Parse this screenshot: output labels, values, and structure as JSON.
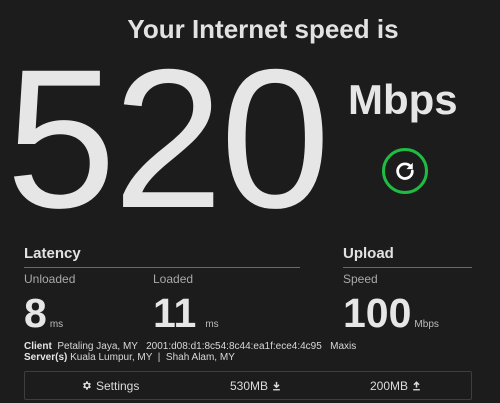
{
  "header": {
    "title": "Your Internet speed is"
  },
  "result": {
    "speed": "520",
    "unit": "Mbps"
  },
  "refresh_button": {
    "icon": "refresh-icon",
    "accent": "#1fbb42"
  },
  "latency": {
    "title": "Latency",
    "unloaded": {
      "label": "Unloaded",
      "value": "8",
      "unit": "ms"
    },
    "loaded": {
      "label": "Loaded",
      "value": "11",
      "unit": "ms"
    }
  },
  "upload": {
    "title": "Upload",
    "speed": {
      "label": "Speed",
      "value": "100",
      "unit": "Mbps"
    }
  },
  "client": {
    "label": "Client",
    "text": "Petaling Jaya, MY   2001:d08:d1:8c54:8c44:ea1f:ece4:4c95   Maxis"
  },
  "servers": {
    "label": "Server(s)",
    "text": "Kuala Lumpur, MY  |  Shah Alam, MY"
  },
  "settings_bar": {
    "settings_label": "Settings",
    "settings_icon": "gear-icon",
    "download_data": "530MB",
    "download_icon": "download-arrow-icon",
    "upload_data": "200MB",
    "upload_icon": "upload-arrow-icon"
  }
}
